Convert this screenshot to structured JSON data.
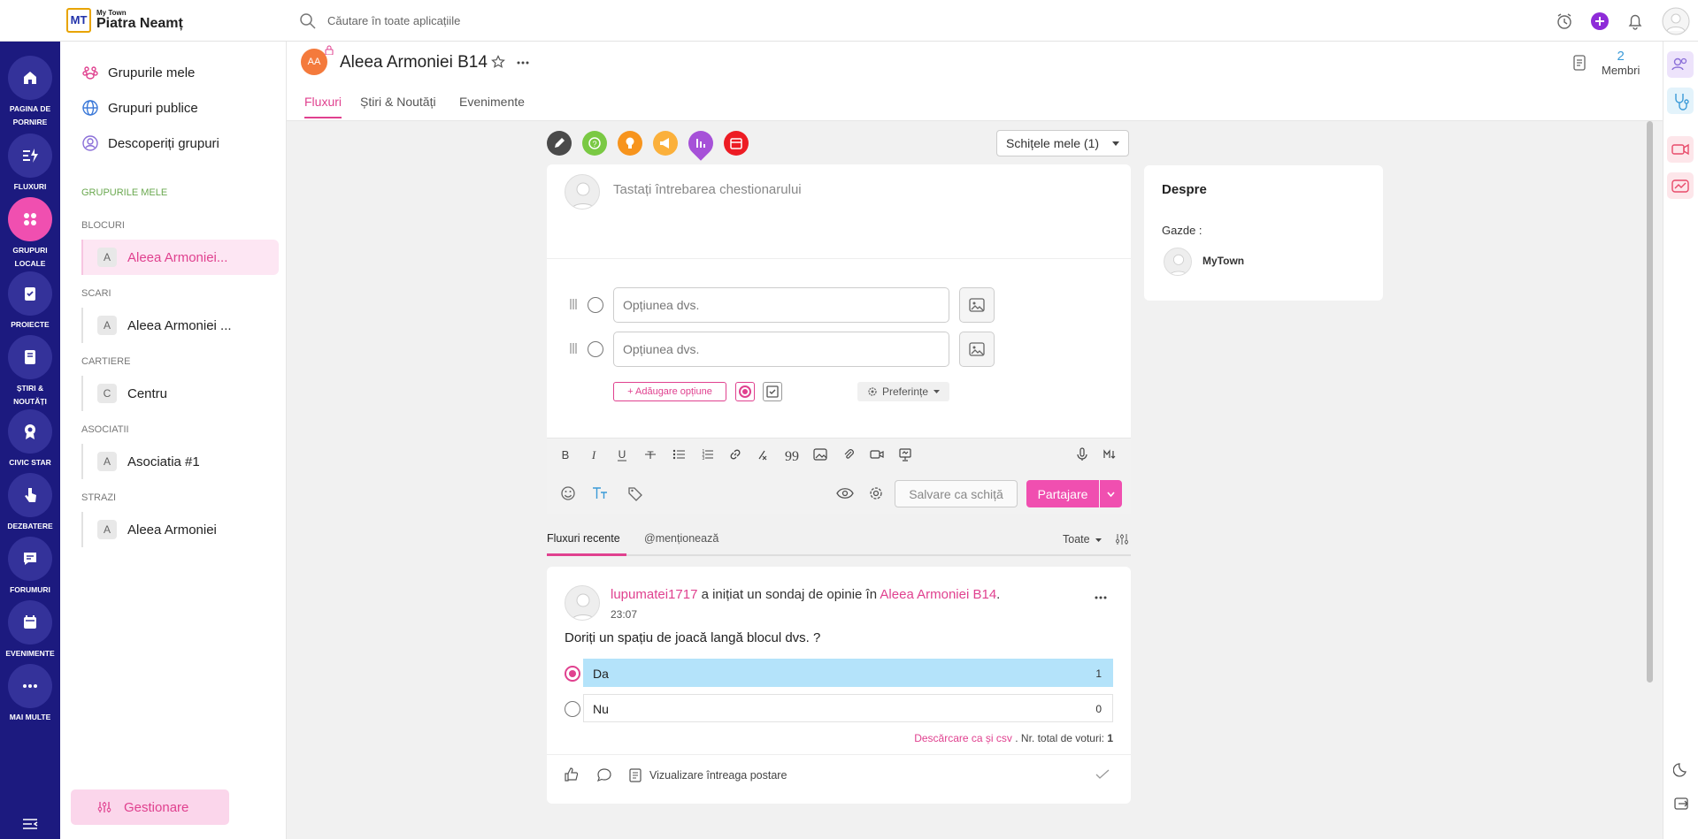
{
  "app": {
    "brand_small": "My Town",
    "brand_name": "Piatra Neamț",
    "logo_text": "MT"
  },
  "search": {
    "placeholder": "Căutare în toate aplicațiile"
  },
  "nav": [
    {
      "label": "PAGINA DE PORNIRE",
      "icon": "home-icon"
    },
    {
      "label": "FLUXURI",
      "icon": "feeds-icon"
    },
    {
      "label": "GRUPURI LOCALE",
      "icon": "groups-icon"
    },
    {
      "label": "PROIECTE",
      "icon": "clipboard-icon"
    },
    {
      "label": "ȘTIRI & NOUTĂȚI",
      "icon": "news-icon"
    },
    {
      "label": "CIVIC STAR",
      "icon": "award-icon"
    },
    {
      "label": "DEZBATERE",
      "icon": "hand-icon"
    },
    {
      "label": "FORUMURI",
      "icon": "chat-icon"
    },
    {
      "label": "EVENIMENTE",
      "icon": "calendar-icon"
    },
    {
      "label": "MAI MULTE",
      "icon": "more-icon"
    }
  ],
  "sidebar": {
    "links": [
      "Grupurile mele",
      "Grupuri publice",
      "Descoperiți grupuri"
    ],
    "my_groups_header": "GRUPURILE MELE",
    "sections": [
      {
        "title": "BLOCURI",
        "items": [
          {
            "avatar": "A",
            "name": "Aleea Armoniei..."
          }
        ]
      },
      {
        "title": "SCARI",
        "items": [
          {
            "avatar": "A",
            "name": "Aleea Armoniei ..."
          }
        ]
      },
      {
        "title": "CARTIERE",
        "items": [
          {
            "avatar": "C",
            "name": "Centru"
          }
        ]
      },
      {
        "title": "ASOCIATII",
        "items": [
          {
            "avatar": "A",
            "name": "Asociatia #1"
          }
        ]
      },
      {
        "title": "STRAZI",
        "items": [
          {
            "avatar": "A",
            "name": "Aleea Armoniei"
          }
        ]
      }
    ],
    "manage_label": "Gestionare"
  },
  "group": {
    "initials": "AA",
    "title": "Aleea Armoniei B14",
    "members_count": "2",
    "members_label": "Membri",
    "tabs": [
      "Fluxuri",
      "Știri & Noutăți",
      "Evenimente"
    ]
  },
  "composer": {
    "drafts_label": "Schițele mele (1)",
    "question_placeholder": "Tastați întrebarea chestionarului",
    "option_placeholder": "Opțiunea dvs.",
    "add_option_label": "+ Adăugare opțiune",
    "preferences_label": "Preferințe",
    "save_draft_label": "Salvare ca schiță",
    "share_label": "Partajare"
  },
  "feed": {
    "tabs": [
      "Fluxuri recente",
      "@menționează"
    ],
    "filter_label": "Toate"
  },
  "post": {
    "author": "lupumatei1717",
    "action_text": " a inițiat un sondaj de opinie în ",
    "group_link": "Aleea Armoniei B14",
    "time": "23:07",
    "question": "Doriți un spațiu de joacă langă blocul dvs. ?",
    "options": [
      {
        "label": "Da",
        "votes": "1"
      },
      {
        "label": "Nu",
        "votes": "0"
      }
    ],
    "download_label": "Descărcare ca și csv",
    "total_label": ". Nr. total de voturi:",
    "total_value": "1",
    "view_full_label": "Vizualizare întreaga postare"
  },
  "about": {
    "title": "Despre",
    "hosts_label": "Gazde :",
    "host_name": "MyTown"
  },
  "colors": {
    "nav_bg": "#1c1a7f",
    "accent": "#f04fb0",
    "poll_fill": "#b4e3fa"
  }
}
